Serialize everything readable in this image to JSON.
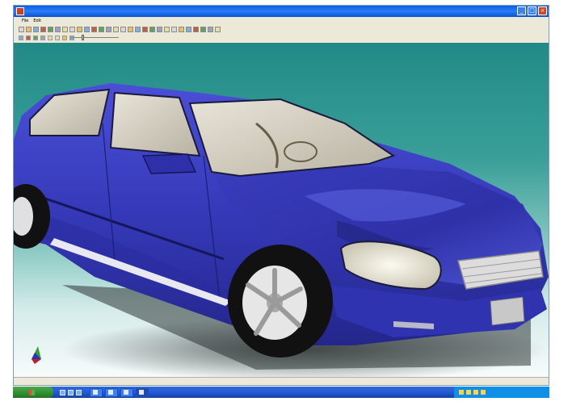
{
  "window": {
    "title": "",
    "controls": {
      "minimize": "_",
      "maximize": "□",
      "close": "×"
    }
  },
  "menu": {
    "items": [
      "File",
      "Edit",
      "",
      "",
      "",
      "",
      "",
      "",
      "",
      ""
    ]
  },
  "toolbar": {
    "icons": [
      "new-icon",
      "open-icon",
      "save-icon",
      "print-icon",
      "undo-icon",
      "redo-icon",
      "cut-icon",
      "copy-icon",
      "paste-icon",
      "select-icon",
      "pan-icon",
      "zoom-icon",
      "rotate-icon",
      "shade-icon",
      "wireframe-icon",
      "light-icon",
      "camera-icon",
      "measure-icon",
      "line-icon",
      "circle-icon",
      "curve-icon",
      "surface-icon",
      "point-icon",
      "grid-icon",
      "color-icon",
      "texture-icon",
      "render-icon",
      "settings-icon"
    ]
  },
  "toolbar2": {
    "icons": [
      "view-front-icon",
      "view-top-icon",
      "view-side-icon",
      "view-iso-icon",
      "fit-icon",
      "zoom-box-icon",
      "zoom-out-icon",
      "light-icon-2"
    ]
  },
  "viewport": {
    "subject": "car-render",
    "colors": {
      "car_body": "#3b3fc0",
      "background_top": "#228a86",
      "background_bottom": "#f7fbfb"
    }
  },
  "taskbar": {
    "start_label": "",
    "tasks": [
      "",
      "",
      "",
      "",
      ""
    ],
    "clock": ""
  }
}
